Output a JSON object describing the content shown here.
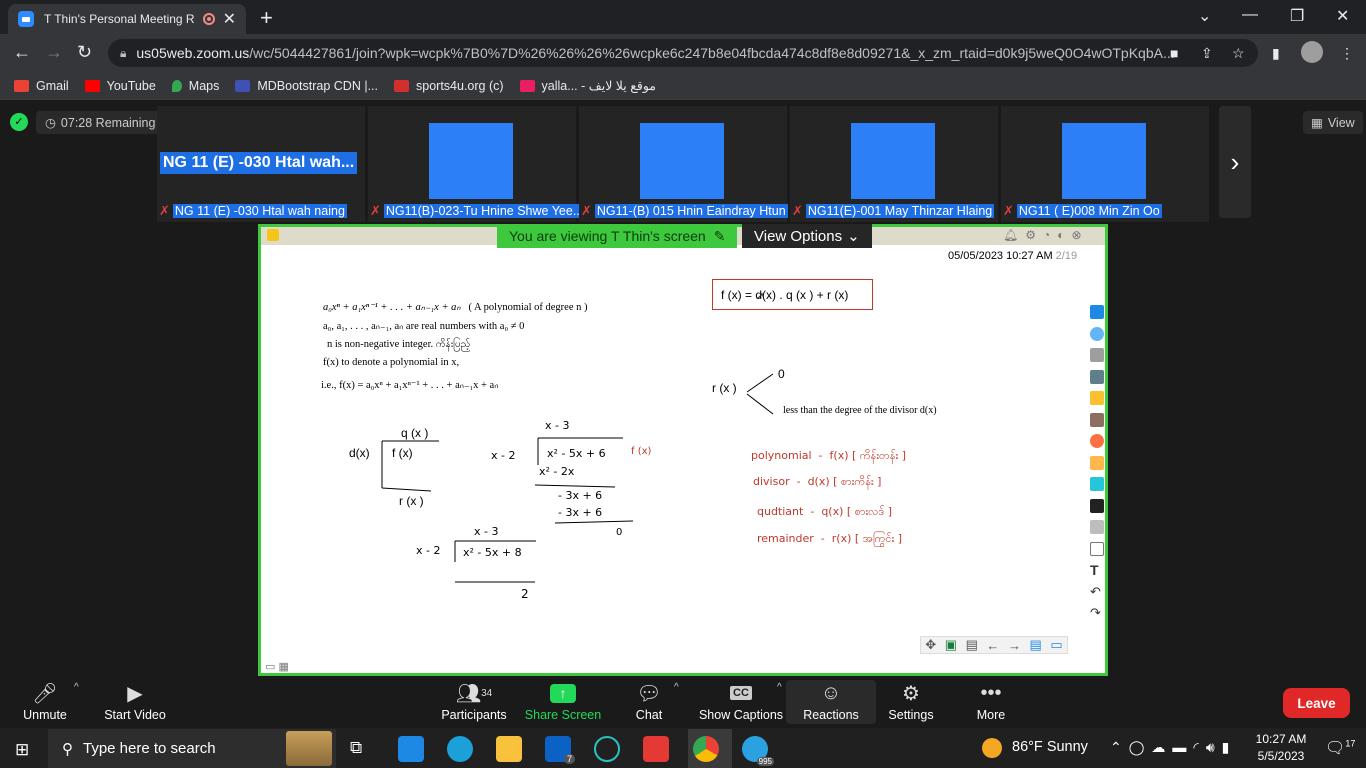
{
  "browser": {
    "tab_title": "T Thin's Personal Meeting Ro",
    "url_host": "us05web.zoom.us",
    "url_path": "/wc/5044427861/join?wpk=wcpk%7B0%7D%26%26%26%26wcpke6c247b8e04fbcda474c8df8e8d09271&_x_zm_rtaid=d0k9j5weQ0O4wOTpKqbA...",
    "bookmarks": [
      {
        "label": "Gmail",
        "color": "#ea4335"
      },
      {
        "label": "YouTube",
        "color": "#ff0000"
      },
      {
        "label": "Maps",
        "color": "#34a853"
      },
      {
        "label": "MDBootstrap CDN |...",
        "color": "#3f51b5"
      },
      {
        "label": "sports4u.org (c)",
        "color": "#d32f2f"
      },
      {
        "label": "yalla... - موقع يلا لايف",
        "color": "#e91e63"
      }
    ]
  },
  "meeting": {
    "timer": "07:28 Remaining",
    "view_label": "View",
    "active_speaker_big": "NG 11 (E) -030 Htal wah...",
    "participants": [
      {
        "name": "NG 11 (E) -030 Htal wah naing",
        "video": false
      },
      {
        "name": "NG11(B)-023-Tu Hnine Shwe Yee...",
        "video": true
      },
      {
        "name": "NG11-(B) 015 Hnin Eaindray Htun",
        "video": true
      },
      {
        "name": "NG11(E)-001 May Thinzar Hlaing",
        "video": true
      },
      {
        "name": "NG11 ( E)008 Min Zin Oo",
        "video": true
      }
    ],
    "viewing_banner": "You are viewing T Thin's screen",
    "view_options": "View Options"
  },
  "whiteboard": {
    "date": "05/05/2023",
    "time": "10:27 AM",
    "page": "2/19",
    "line1": "a₀xⁿ + a₁xⁿ⁻¹ + . . . + aₙ₋₁x + aₙ",
    "line1_note": "( A polynomial of degree n )",
    "line2": "a₀, a₁, . . . , aₙ₋₁, aₙ are real numbers with a₀ ≠ 0",
    "line3": "n is non-negative integer.",
    "line3_note": "ကိန်းပြည့်",
    "line4": "f(x) to denote a polynomial in x,",
    "line5": "i.e., f(x) = a₀xⁿ + a₁xⁿ⁻¹ + . . . + aₙ₋₁x + aₙ",
    "box_formula": "f (x)  =  d(x) . q (x )  + r (x)",
    "rx_label": "r (x )",
    "rx_zero": "0",
    "rx_less": "less than the degree of the divisor d(x)",
    "div_d": "d(x)",
    "div_q": "q (x )",
    "div_f": "f (x)",
    "div_r": "r (x )",
    "hw1_quot": "x - 3",
    "hw1_div": "x - 2",
    "hw1_dividend": "x² - 5x + 6",
    "hw1_fx": "f (x)",
    "hw1_sub1": "x² - 2x",
    "hw1_rem1": "- 3x + 6",
    "hw1_sub2": "- 3x + 6",
    "hw1_zero": "0",
    "hw2_quot": "x - 3",
    "hw2_div": "x - 2",
    "hw2_dividend": "x² - 5x + 8",
    "hw2_rem": "2",
    "defs": [
      {
        "term": "polynomial",
        "sym": "f(x)",
        "mm": "[ ကိန်းတန်း ]"
      },
      {
        "term": "divisor",
        "sym": "d(x)",
        "mm": "[ စားကိန်း ]"
      },
      {
        "term": "qudtiant",
        "sym": "q(x)",
        "mm": "[ စားလဒ် ]"
      },
      {
        "term": "remainder",
        "sym": "r(x)",
        "mm": "[ အကြွင်း ]"
      }
    ]
  },
  "toolbar": {
    "unmute": "Unmute",
    "start_video": "Start Video",
    "participants": "Participants",
    "participants_count": "34",
    "share_screen": "Share Screen",
    "chat": "Chat",
    "show_captions": "Show Captions",
    "reactions": "Reactions",
    "settings": "Settings",
    "more": "More",
    "leave": "Leave"
  },
  "taskbar": {
    "search_placeholder": "Type here to search",
    "weather": "86°F  Sunny",
    "time": "10:27 AM",
    "date": "5/5/2023",
    "mail_badge": "7",
    "telegram_badge": "995",
    "notif_badge": "17"
  }
}
